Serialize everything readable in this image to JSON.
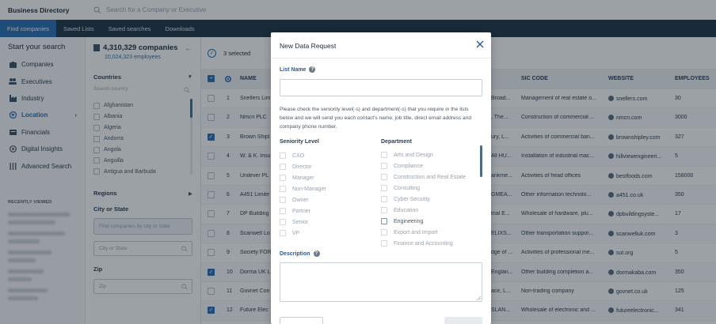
{
  "app": {
    "title": "Business Directory",
    "search_placeholder": "Search for a Company or Executive"
  },
  "nav": [
    "Find companies",
    "Saved Lists",
    "Saved searches",
    "Downloads"
  ],
  "sidebar": {
    "title": "Start your search",
    "items": [
      {
        "label": "Companies",
        "icon": "building-icon"
      },
      {
        "label": "Executives",
        "icon": "people-icon"
      },
      {
        "label": "Industry",
        "icon": "factory-icon"
      },
      {
        "label": "Location",
        "icon": "globe-icon"
      },
      {
        "label": "Financials",
        "icon": "financials-icon"
      },
      {
        "label": "Digital Insights",
        "icon": "digital-icon"
      },
      {
        "label": "Advanced Search",
        "icon": "sliders-icon"
      }
    ],
    "recently_viewed_label": "RECENTLY VIEWED"
  },
  "filters": {
    "company_count": "4,310,329 companies",
    "employee_count": "10,024,323 employees",
    "countries_label": "Countries",
    "search_country_placeholder": "Search country",
    "countries": [
      "Afghanistan",
      "Albania",
      "Algeria",
      "Andorra",
      "Angola",
      "Anguilla",
      "Antigua and Barbuda"
    ],
    "regions_label": "Regions",
    "city_state_label": "City or State",
    "city_state_hint": "Find companies by city or state",
    "city_state_placeholder": "City or State",
    "zip_label": "Zip",
    "zip_placeholder": "Zip"
  },
  "table": {
    "selected_text": "3 selected",
    "columns": [
      "NAME",
      "SIC CODE",
      "WEBSITE",
      "EMPLOYEES"
    ],
    "rows": [
      {
        "num": "1",
        "name": "Snellers Lim",
        "addr": "Broad...",
        "sic": "Management of real estate o...",
        "website": "snellers.com",
        "employees": "30",
        "checked": false
      },
      {
        "num": "2",
        "name": "Nmcn PLC",
        "addr": ", The...",
        "sic": "Construction of commercial ...",
        "website": "nmcn.com",
        "employees": "3000",
        "checked": false
      },
      {
        "num": "3",
        "name": "Brown Shipl",
        "addr": "ury, L...",
        "sic": "Activities of commercial ban...",
        "website": "brownshipley.com",
        "employees": "327",
        "checked": true
      },
      {
        "num": "4",
        "name": "W. & K. Insu",
        "addr": "48 HU...",
        "sic": "Installation of industrial mac...",
        "website": "hillviewengineeri...",
        "employees": "5",
        "checked": false
      },
      {
        "num": "5",
        "name": "Unilever PL",
        "addr": "ankme...",
        "sic": "Activities of head offices",
        "website": "bestfoods.com",
        "employees": "158000",
        "checked": false
      },
      {
        "num": "6",
        "name": "A451 Limite",
        "addr": "GMEA...",
        "sic": "Other information technolo...",
        "website": "a451.co.uk",
        "employees": "350",
        "checked": false
      },
      {
        "num": "7",
        "name": "DP Building",
        "addr": "trial E...",
        "sic": "Wholesale of hardware, plu...",
        "website": "dpbuildingsyste...",
        "employees": "17",
        "checked": false
      },
      {
        "num": "8",
        "name": "Scanwell Lo",
        "addr": "ELIXS...",
        "sic": "Other transportation suppor...",
        "website": "scanwelluk.com",
        "employees": "3",
        "checked": false
      },
      {
        "num": "9",
        "name": "Society FOR",
        "addr": "dge of ...",
        "sic": "Activities of professional me...",
        "website": "sut.org",
        "employees": "5",
        "checked": false
      },
      {
        "num": "10",
        "name": "Dorma UK L",
        "addr": "Englan...",
        "sic": "Other building completion a...",
        "website": "dormakaba.com",
        "employees": "350",
        "checked": true
      },
      {
        "num": "11",
        "name": "Govnet Con",
        "addr": "ace, L...",
        "sic": "Non-trading company",
        "website": "govnet.co.uk",
        "employees": "125",
        "checked": false
      },
      {
        "num": "12",
        "name": "Future Elec",
        "addr": "SLAN...",
        "sic": "Wholesale of electronic and ...",
        "website": "futureelectronic...",
        "employees": "341",
        "checked": true
      }
    ]
  },
  "modal": {
    "title": "New Data Request",
    "list_name_label": "List Name",
    "instructions": "Please check the seniority level(-s) and department(-s) that you require in the lists below and we will send you each contact's name, job title, direct email address and company phone number.",
    "seniority_label": "Seniority Level",
    "seniority_options": [
      "CXO",
      "Director",
      "Manager",
      "Non-Manager",
      "Owner",
      "Partner",
      "Senior",
      "VP"
    ],
    "department_label": "Department",
    "department_options": [
      "Arts and Design",
      "Compliance",
      "Construction and Real Estate",
      "Consulting",
      "Cyber Security",
      "Education",
      "Engineering",
      "Export and Import",
      "Finance and Accounting"
    ],
    "enabled_department": "Engineering",
    "description_label": "Description"
  }
}
